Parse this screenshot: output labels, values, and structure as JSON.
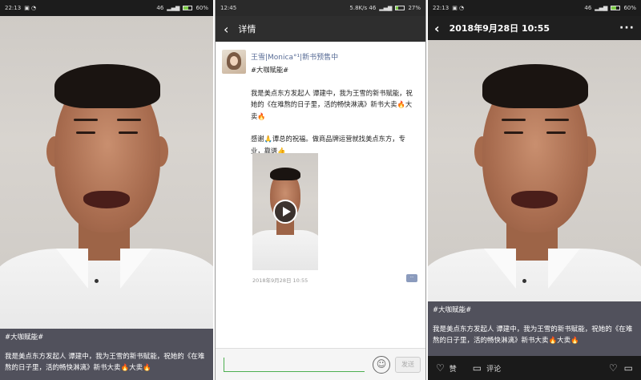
{
  "screens": [
    {
      "status": {
        "time": "22:13",
        "signal": "46 ",
        "battery": "60%"
      },
      "caption": {
        "hashtag": "#大咖赋能#",
        "text": "我是美点东方发起人 谭建中，我为王雪的新书赋能，祝她的《在难熬的日子里，活的畅快淋漓》新书大卖🔥大卖🔥"
      }
    },
    {
      "status": {
        "time": "12:45",
        "signal": "5.8K/s 46",
        "battery": "27%"
      },
      "nav": {
        "back_icon": "chevron-left-icon",
        "title": "详情"
      },
      "post": {
        "username": "王雪|Monica°¹|新书预售中",
        "hashtag": "#大咖赋能#",
        "para1": "我是美点东方发起人 谭建中，我为王雪的新书赋能，祝她的《在难熬的日子里，活的畅快淋漓》新书大卖🔥大卖🔥",
        "para2": "感谢🙏谭总的祝福。做商品牌运营就找美点东方，专业，靠谱👍",
        "timestamp": "2018年9月28日  10:55"
      },
      "input": {
        "placeholder": "",
        "send_label": "发送"
      }
    },
    {
      "status": {
        "time": "22:13",
        "signal": "46",
        "battery": "60%"
      },
      "nav": {
        "title": "2018年9月28日  10:55"
      },
      "caption": {
        "hashtag": "#大咖赋能#",
        "text": "我是美点东方发起人 谭建中，我为王雪的新书赋能，祝她的《在难熬的日子里，活的畅快淋漓》新书大卖🔥大卖🔥"
      },
      "actions": {
        "like_label": "赞",
        "comment_label": "评论"
      }
    }
  ],
  "colors": {
    "link": "#576b95",
    "navbar": "#2e2e2e",
    "input_accent": "#4caf50"
  }
}
